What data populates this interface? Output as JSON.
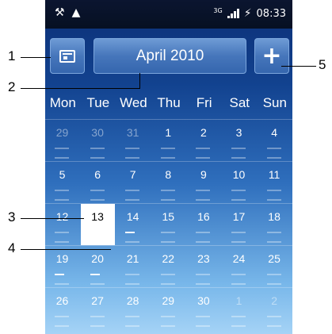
{
  "status_bar": {
    "left_icons": [
      "usb-debug-icon",
      "warning-icon"
    ],
    "network_label": "3G",
    "time": "08:33"
  },
  "toolbar": {
    "month_label": "April 2010",
    "add_label": "+"
  },
  "weekdays": [
    "Mon",
    "Tue",
    "Wed",
    "Thu",
    "Fri",
    "Sat",
    "Sun"
  ],
  "weeks": [
    [
      "29",
      "30",
      "31",
      "1",
      "2",
      "3",
      "4"
    ],
    [
      "5",
      "6",
      "7",
      "8",
      "9",
      "10",
      "11"
    ],
    [
      "12",
      "13",
      "14",
      "15",
      "16",
      "17",
      "18"
    ],
    [
      "19",
      "20",
      "21",
      "22",
      "23",
      "24",
      "25"
    ],
    [
      "26",
      "27",
      "28",
      "29",
      "30",
      "1",
      "2"
    ]
  ],
  "callouts": [
    "1",
    "2",
    "3",
    "4",
    "5"
  ]
}
